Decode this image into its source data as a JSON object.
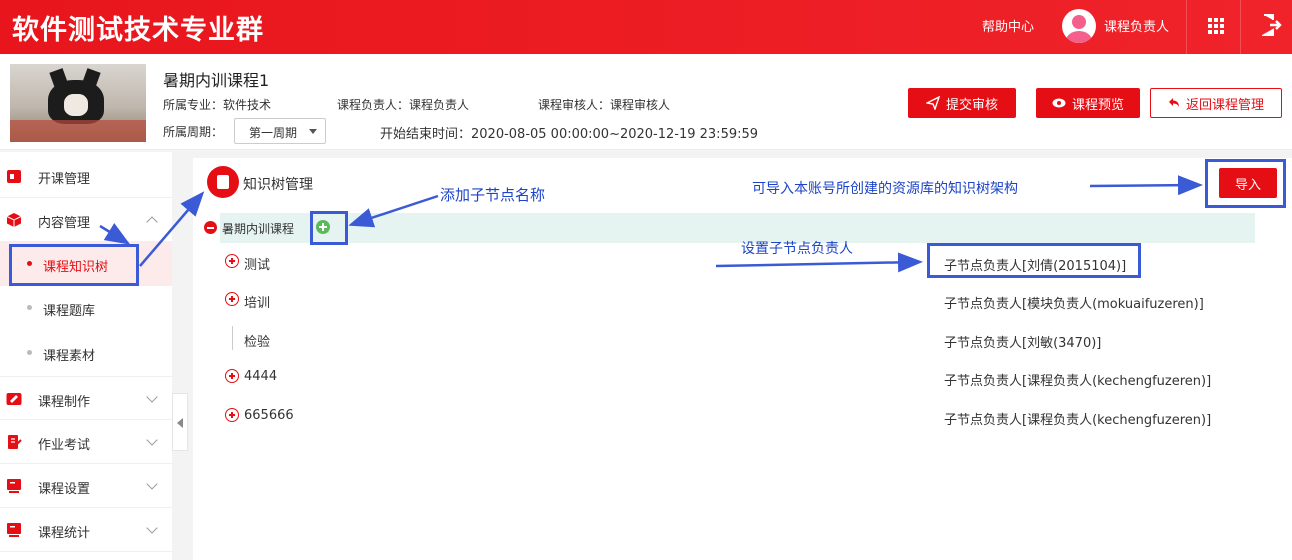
{
  "header": {
    "brand": "软件测试技术专业群",
    "help": "帮助中心",
    "user_label": "课程负责人"
  },
  "course": {
    "title": "暑期内训课程1",
    "major": "所属专业：软件技术",
    "owner": "课程负责人：课程负责人",
    "reviewer": "课程审核人：课程审核人",
    "period_label": "所属周期：",
    "period_value": "第一周期",
    "time_range": "开始结束时间：2020-08-05 00:00:00~2020-12-19 23:59:59"
  },
  "actions": {
    "submit": "提交审核",
    "preview": "课程预览",
    "back": "返回课程管理"
  },
  "sidebar": {
    "items": [
      {
        "label": "开课管理"
      },
      {
        "label": "内容管理"
      },
      {
        "label": "课程知识树"
      },
      {
        "label": "课程题库"
      },
      {
        "label": "课程素材"
      },
      {
        "label": "课程制作"
      },
      {
        "label": "作业考试"
      },
      {
        "label": "课程设置"
      },
      {
        "label": "课程统计"
      }
    ]
  },
  "panel": {
    "title": "知识树管理",
    "import_label": "导入",
    "root_label": "暑期内训课程"
  },
  "tree": [
    {
      "label": "测试",
      "owner": "子节点负责人[刘倩(2015104)]"
    },
    {
      "label": "培训",
      "owner": "子节点负责人[模块负责人(mokuaifuzeren)]"
    },
    {
      "label": "检验",
      "owner": "子节点负责人[刘敏(3470)]"
    },
    {
      "label": "4444",
      "owner": "子节点负责人[课程负责人(kechengfuzeren)]"
    },
    {
      "label": "665666",
      "owner": "子节点负责人[课程负责人(kechengfuzeren)]"
    }
  ],
  "annotations": {
    "add_child": "添加子节点名称",
    "import_hint": "可导入本账号所创建的资源库的知识树架构",
    "owner_hint": "设置子节点负责人"
  },
  "colors": {
    "brand_red": "#e50e14",
    "annotation_blue": "#3b5bd6",
    "root_row_bg": "#e6f4f1"
  }
}
